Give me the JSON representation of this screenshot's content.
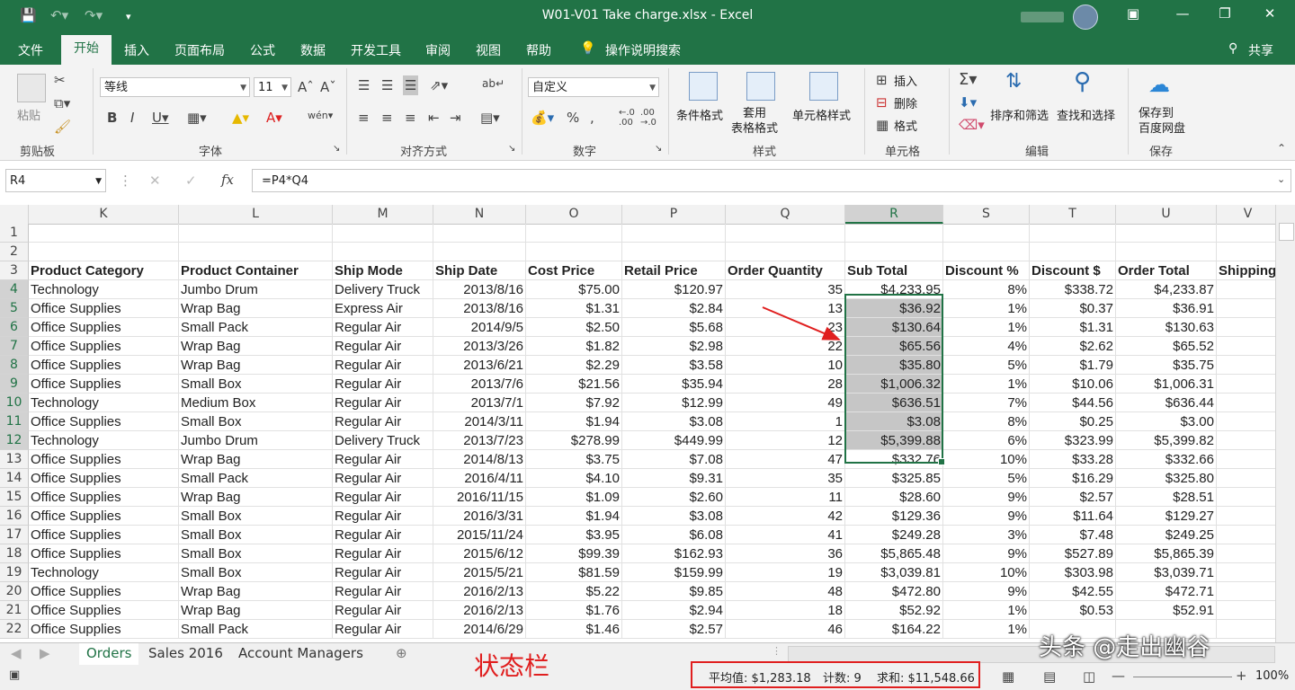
{
  "window": {
    "title": "W01-V01 Take charge.xlsx  -  Excel"
  },
  "tabs": [
    "文件",
    "开始",
    "插入",
    "页面布局",
    "公式",
    "数据",
    "开发工具",
    "审阅",
    "视图",
    "帮助",
    "操作说明搜索"
  ],
  "share_label": "共享",
  "ribbon": {
    "clipboard": {
      "paste": "粘贴",
      "label": "剪贴板"
    },
    "font": {
      "name": "等线",
      "size": "11",
      "label": "字体"
    },
    "alignment": {
      "label": "对齐方式"
    },
    "number": {
      "format": "自定义",
      "label": "数字"
    },
    "styles": {
      "conditional": "条件格式",
      "table": "套用\n表格格式",
      "cell": "单元格样式",
      "label": "样式"
    },
    "cells": {
      "insert": "插入",
      "delete": "删除",
      "format": "格式",
      "label": "单元格"
    },
    "editing": {
      "sortfilter": "排序和筛选",
      "findselect": "查找和选择",
      "label": "编辑"
    },
    "save": {
      "btn": "保存到\n百度网盘",
      "label": "保存"
    }
  },
  "formula_bar": {
    "name_box": "R4",
    "formula": "=P4*Q4"
  },
  "columns": [
    "K",
    "L",
    "M",
    "N",
    "O",
    "P",
    "Q",
    "R",
    "S",
    "T",
    "U",
    "V"
  ],
  "selected_column": "R",
  "row_numbers": [
    "1",
    "2",
    "3",
    "4",
    "5",
    "6",
    "7",
    "8",
    "9",
    "10",
    "11",
    "12",
    "13",
    "14",
    "15",
    "16",
    "17",
    "18",
    "19",
    "20",
    "21",
    "22"
  ],
  "header_row": [
    "Product Category",
    "Product Container",
    "Ship Mode",
    "Ship Date",
    "Cost Price",
    "Retail Price",
    "Order Quantity",
    "Sub Total",
    "Discount %",
    "Discount $",
    "Order Total",
    "Shipping"
  ],
  "rows": [
    [
      "Technology",
      "Jumbo Drum",
      "Delivery Truck",
      "2013/8/16",
      "$75.00",
      "$120.97",
      "35",
      "$4,233.95",
      "8%",
      "$338.72",
      "$4,233.87",
      ""
    ],
    [
      "Office Supplies",
      "Wrap Bag",
      "Express Air",
      "2013/8/16",
      "$1.31",
      "$2.84",
      "13",
      "$36.92",
      "1%",
      "$0.37",
      "$36.91",
      ""
    ],
    [
      "Office Supplies",
      "Small Pack",
      "Regular Air",
      "2014/9/5",
      "$2.50",
      "$5.68",
      "23",
      "$130.64",
      "1%",
      "$1.31",
      "$130.63",
      ""
    ],
    [
      "Office Supplies",
      "Wrap Bag",
      "Regular Air",
      "2013/3/26",
      "$1.82",
      "$2.98",
      "22",
      "$65.56",
      "4%",
      "$2.62",
      "$65.52",
      ""
    ],
    [
      "Office Supplies",
      "Wrap Bag",
      "Regular Air",
      "2013/6/21",
      "$2.29",
      "$3.58",
      "10",
      "$35.80",
      "5%",
      "$1.79",
      "$35.75",
      ""
    ],
    [
      "Office Supplies",
      "Small Box",
      "Regular Air",
      "2013/7/6",
      "$21.56",
      "$35.94",
      "28",
      "$1,006.32",
      "1%",
      "$10.06",
      "$1,006.31",
      ""
    ],
    [
      "Technology",
      "Medium Box",
      "Regular Air",
      "2013/7/1",
      "$7.92",
      "$12.99",
      "49",
      "$636.51",
      "7%",
      "$44.56",
      "$636.44",
      ""
    ],
    [
      "Office Supplies",
      "Small Box",
      "Regular Air",
      "2014/3/11",
      "$1.94",
      "$3.08",
      "1",
      "$3.08",
      "8%",
      "$0.25",
      "$3.00",
      ""
    ],
    [
      "Technology",
      "Jumbo Drum",
      "Delivery Truck",
      "2013/7/23",
      "$278.99",
      "$449.99",
      "12",
      "$5,399.88",
      "6%",
      "$323.99",
      "$5,399.82",
      ""
    ],
    [
      "Office Supplies",
      "Wrap Bag",
      "Regular Air",
      "2014/8/13",
      "$3.75",
      "$7.08",
      "47",
      "$332.76",
      "10%",
      "$33.28",
      "$332.66",
      ""
    ],
    [
      "Office Supplies",
      "Small Pack",
      "Regular Air",
      "2016/4/11",
      "$4.10",
      "$9.31",
      "35",
      "$325.85",
      "5%",
      "$16.29",
      "$325.80",
      ""
    ],
    [
      "Office Supplies",
      "Wrap Bag",
      "Regular Air",
      "2016/11/15",
      "$1.09",
      "$2.60",
      "11",
      "$28.60",
      "9%",
      "$2.57",
      "$28.51",
      ""
    ],
    [
      "Office Supplies",
      "Small Box",
      "Regular Air",
      "2016/3/31",
      "$1.94",
      "$3.08",
      "42",
      "$129.36",
      "9%",
      "$11.64",
      "$129.27",
      ""
    ],
    [
      "Office Supplies",
      "Small Box",
      "Regular Air",
      "2015/11/24",
      "$3.95",
      "$6.08",
      "41",
      "$249.28",
      "3%",
      "$7.48",
      "$249.25",
      ""
    ],
    [
      "Office Supplies",
      "Small Box",
      "Regular Air",
      "2015/6/12",
      "$99.39",
      "$162.93",
      "36",
      "$5,865.48",
      "9%",
      "$527.89",
      "$5,865.39",
      ""
    ],
    [
      "Technology",
      "Small Box",
      "Regular Air",
      "2015/5/21",
      "$81.59",
      "$159.99",
      "19",
      "$3,039.81",
      "10%",
      "$303.98",
      "$3,039.71",
      ""
    ],
    [
      "Office Supplies",
      "Wrap Bag",
      "Regular Air",
      "2016/2/13",
      "$5.22",
      "$9.85",
      "48",
      "$472.80",
      "9%",
      "$42.55",
      "$472.71",
      ""
    ],
    [
      "Office Supplies",
      "Wrap Bag",
      "Regular Air",
      "2016/2/13",
      "$1.76",
      "$2.94",
      "18",
      "$52.92",
      "1%",
      "$0.53",
      "$52.91",
      ""
    ],
    [
      "Office Supplies",
      "Small Pack",
      "Regular Air",
      "2014/6/29",
      "$1.46",
      "$2.57",
      "46",
      "$164.22",
      "1%",
      "",
      "",
      ""
    ]
  ],
  "sheet_tabs": [
    "Orders",
    "Sales 2016",
    "Account Managers"
  ],
  "status": {
    "average": "平均值: $1,283.18",
    "count": "计数: 9",
    "sum": "求和: $11,548.66",
    "zoom": "100%"
  },
  "annotation": {
    "label": "状态栏",
    "color": "#e01f1f"
  },
  "watermark": "头条 @走出幽谷",
  "colors": {
    "accent": "#217346",
    "selection": "#c6c6c6"
  }
}
